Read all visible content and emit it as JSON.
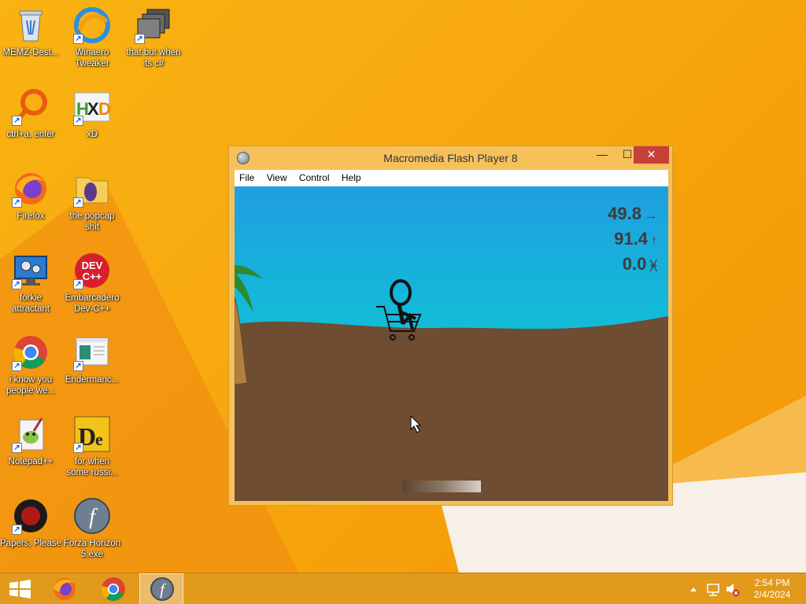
{
  "desktop_icons": [
    {
      "label": "MEMZ-Dest...",
      "icon": "recycle-bin-icon"
    },
    {
      "label": "Winaero\nTweaker",
      "icon": "winaero-icon"
    },
    {
      "label": "that but when\nits c#",
      "icon": "stacked-windows-icon"
    },
    {
      "label": "ctrl+a, enter",
      "icon": "magnifier-ring-icon"
    },
    {
      "label": "xD",
      "icon": "hxd-icon"
    },
    {
      "label": "Firefox",
      "icon": "firefox-icon"
    },
    {
      "label": "the popcap\nshit",
      "icon": "popcap-icon"
    },
    {
      "label": "forkie\nattractant",
      "icon": "computer-gear-icon"
    },
    {
      "label": "Embarcadero\nDev-C++",
      "icon": "devcpp-icon"
    },
    {
      "label": "i know you\npeople we...",
      "icon": "chrome-icon"
    },
    {
      "label": "Endermanc...",
      "icon": "window-app-icon"
    },
    {
      "label": "Notepad++",
      "icon": "notepadpp-icon"
    },
    {
      "label": "for when\nsome russi...",
      "icon": "de-icon"
    },
    {
      "label": "Papers, Please",
      "icon": "papers-please-icon"
    },
    {
      "label": "Forza Horizon\n5.exe",
      "icon": "flash-icon"
    }
  ],
  "window": {
    "title": "Macromedia Flash Player 8",
    "menu": [
      "File",
      "View",
      "Control",
      "Help"
    ],
    "controls": {
      "minimize": "—",
      "maximize": "☐",
      "close": "✕"
    }
  },
  "game": {
    "hud_distance": "49.8",
    "hud_height": "91.4",
    "hud_third": "0.0",
    "arrow_right": "→",
    "arrow_up": "↑",
    "arrow_third": "ᚸ",
    "sky_color": "#1ea8dc",
    "ground_color": "#6e4d32"
  },
  "taskbar": {
    "time": "2:54 PM",
    "date": "2/4/2024",
    "pinned": [
      "start-button",
      "firefox-icon",
      "chrome-icon",
      "flash-icon"
    ]
  },
  "colors": {
    "desktop_bg": "#f7a80e",
    "taskbar": "#e19a1c",
    "window_frame": "#f6c15a",
    "close_button": "#c7403a"
  }
}
